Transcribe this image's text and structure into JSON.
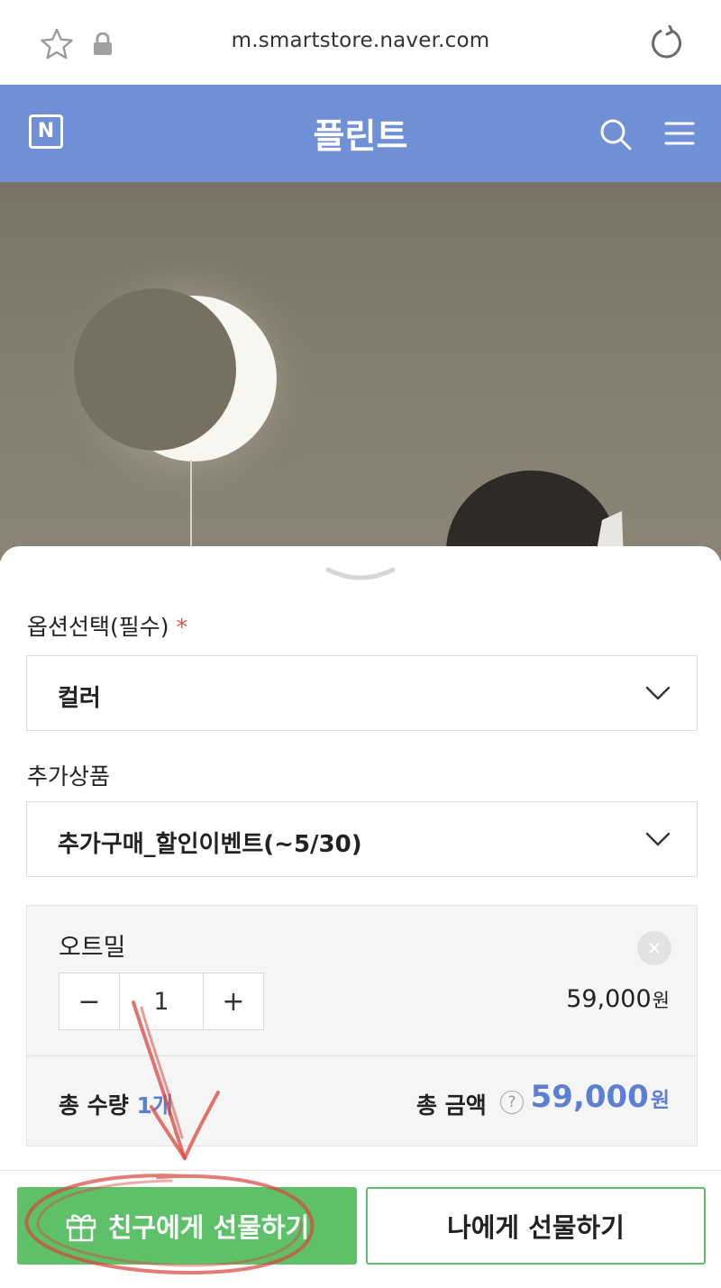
{
  "browser": {
    "url": "m.smartstore.naver.com"
  },
  "store": {
    "logo_letter": "N",
    "title": "플린트"
  },
  "options": {
    "required_label": "옵션선택(필수)",
    "required_mark": "*",
    "required_select_value": "컬러",
    "extra_label": "추가상품",
    "extra_select_value": "추가구매_할인이벤트(~5/30)"
  },
  "selected_item": {
    "name": "오트밀",
    "quantity": "1",
    "price": "59,000",
    "price_unit": "원",
    "minus_symbol": "−",
    "plus_symbol": "+",
    "remove_symbol": "✕"
  },
  "totals": {
    "qty_label": "총 수량",
    "qty_value": "1개",
    "amount_label": "총 금액",
    "help_symbol": "?",
    "amount_value": "59,000",
    "amount_unit": "원"
  },
  "actions": {
    "gift_friend_label": "친구에게 선물하기",
    "gift_me_label": "나에게 선물하기"
  },
  "colors": {
    "header_blue": "#6f8fd6",
    "accent_blue": "#5d7fd0",
    "green": "#5ec16a",
    "annotation_red": "#d9453c"
  },
  "icons": [
    "star-icon",
    "lock-icon",
    "reload-icon",
    "search-icon",
    "menu-icon",
    "chevron-down-icon",
    "close-icon",
    "gift-icon"
  ]
}
